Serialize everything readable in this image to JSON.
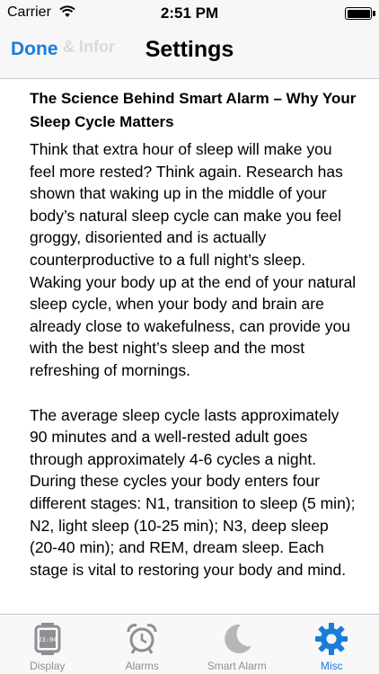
{
  "status_bar": {
    "carrier": "Carrier",
    "time": "2:51 PM"
  },
  "nav": {
    "back_label": "Done",
    "title": "Settings",
    "ghost_text": "& Infor"
  },
  "article": {
    "title": "The Science Behind Smart Alarm – Why Your Sleep Cycle Matters",
    "paragraphs": [
      "Think that extra hour of sleep will make you feel more rested?  Think again. Research has shown that waking up in the middle of your body’s natural sleep cycle can make you feel groggy, disoriented and is actually counterproductive to a full night’s sleep. Waking your body up at the end of your natural sleep cycle, when your body and brain are already close to wakefulness, can provide you with the best night’s sleep and the most refreshing of mornings.",
      "The average sleep cycle lasts approximately 90 minutes and a well-rested adult goes through approximately 4-6 cycles a night.  During these cycles your body enters four different stages: N1, transition to sleep (5 min); N2, light sleep (10-25 min); N3, deep sleep (20-40 min); and REM, dream sleep.  Each stage is vital to restoring your body and mind."
    ]
  },
  "tabs": [
    {
      "label": "Display",
      "icon": "display-icon",
      "active": false
    },
    {
      "label": "Alarms",
      "icon": "alarm-clock-icon",
      "active": false
    },
    {
      "label": "Smart Alarm",
      "icon": "moon-icon",
      "active": false
    },
    {
      "label": "Misc",
      "icon": "gear-icon",
      "active": true
    }
  ],
  "display_icon_time": "23:04",
  "colors": {
    "accent": "#1a7cdb",
    "inactive": "#8e8e93",
    "bar_background": "#f7f7f7"
  }
}
